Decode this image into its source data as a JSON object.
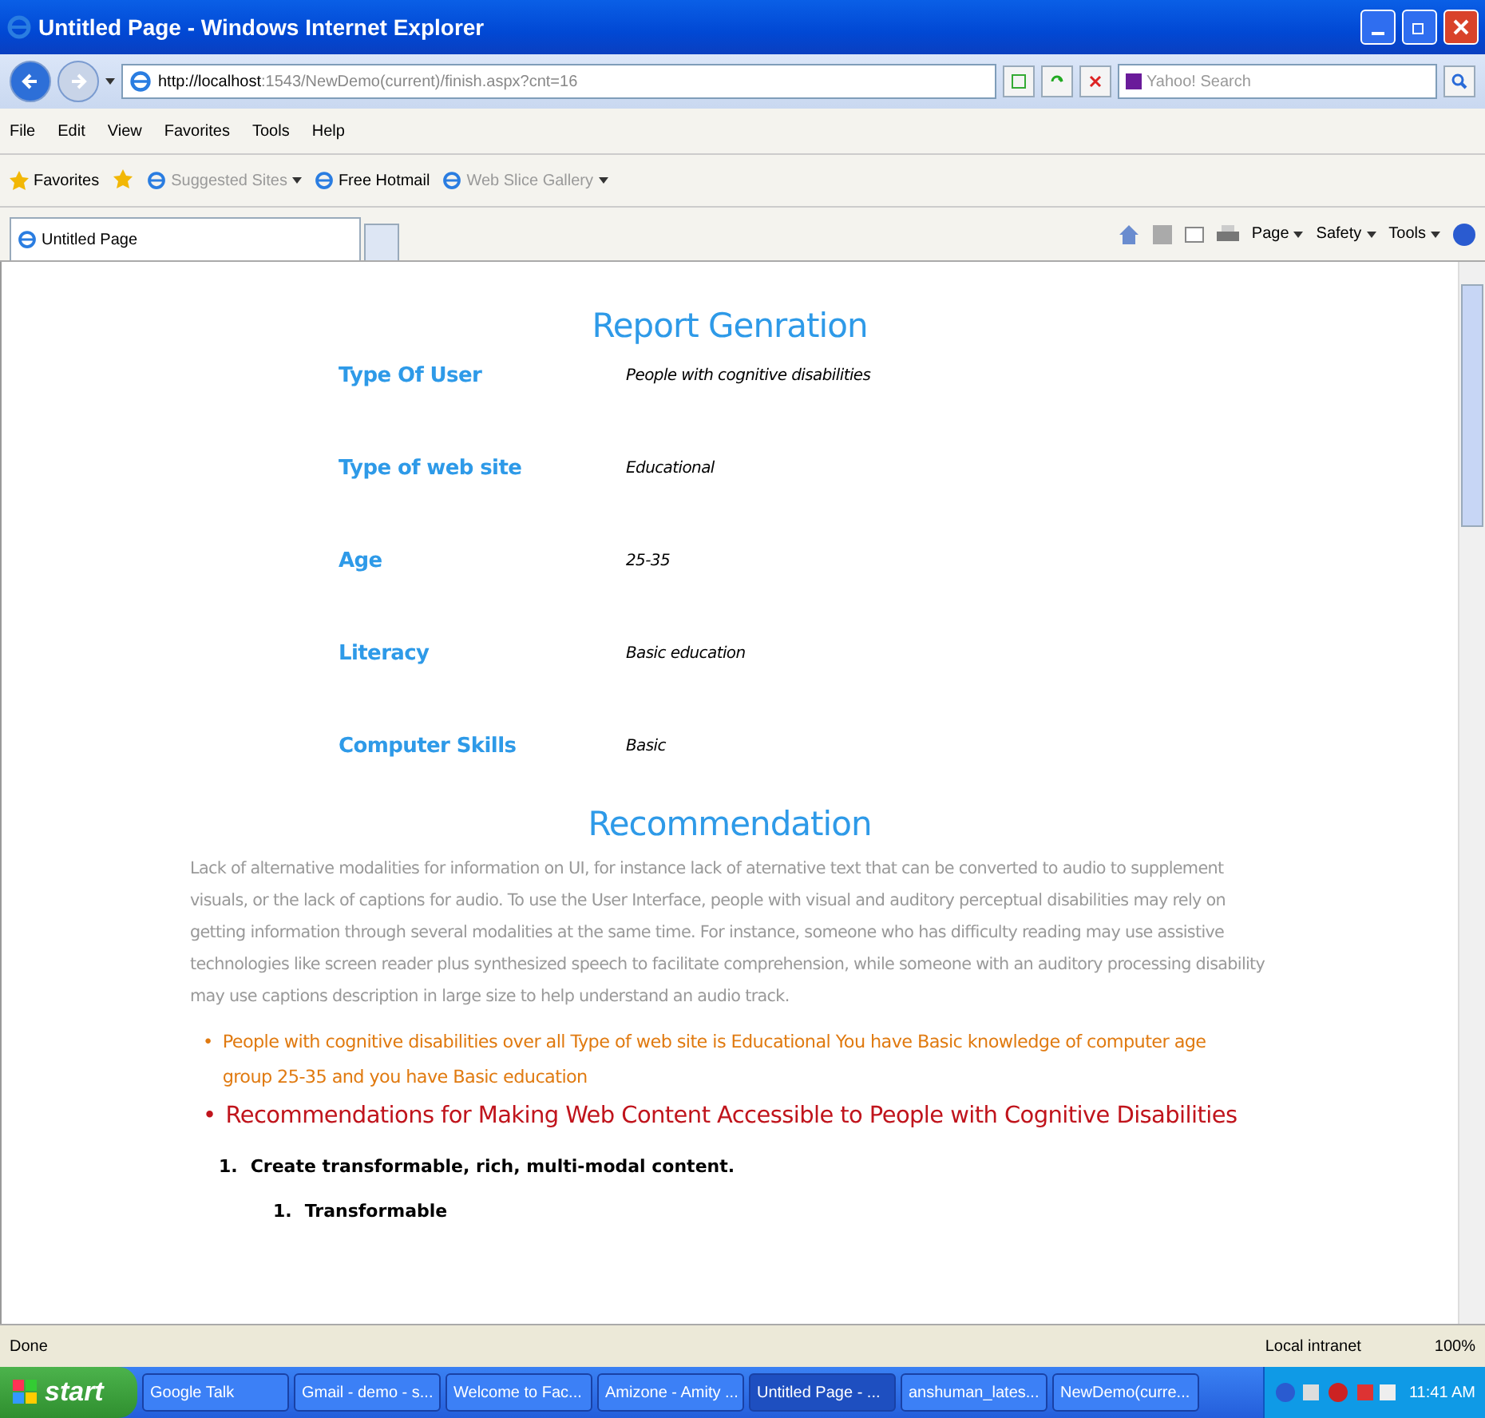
{
  "window": {
    "title": "Untitled Page - Windows Internet Explorer"
  },
  "address_bar": {
    "url_host": "http://localhost",
    "url_rest": ":1543/NewDemo(current)/finish.aspx?cnt=16",
    "search_placeholder": "Yahoo! Search"
  },
  "menu": [
    "File",
    "Edit",
    "View",
    "Favorites",
    "Tools",
    "Help"
  ],
  "favorites_bar": {
    "label": "Favorites",
    "links": [
      {
        "label": "Suggested Sites",
        "dropdown": true,
        "dimmed": true
      },
      {
        "label": "Free Hotmail",
        "dropdown": false,
        "dimmed": false
      },
      {
        "label": "Web Slice Gallery",
        "dropdown": true,
        "dimmed": true
      }
    ]
  },
  "tab": {
    "label": "Untitled Page"
  },
  "command_bar": [
    "Page",
    "Safety",
    "Tools"
  ],
  "page": {
    "title": "Report Genration",
    "fields": [
      {
        "label": "Type Of User",
        "value": "People with cognitive disabilities"
      },
      {
        "label": "Type of web site",
        "value": "Educational"
      },
      {
        "label": "Age",
        "value": "25-35"
      },
      {
        "label": "Literacy",
        "value": "Basic education"
      },
      {
        "label": "Computer Skills",
        "value": "Basic"
      }
    ],
    "recommendation_title": "Recommendation",
    "paragraph": "Lack of alternative modalities for information on UI, for instance lack of aternative text that can be converted to audio to supplement visuals, or the lack of captions for audio. To use the User Interface, people with visual and auditory perceptual disabilities may rely on getting information through several modalities at the same time. For instance, someone who has difficulty reading may use assistive technologies like screen reader plus synthesized speech to facilitate comprehension, while someone with an auditory processing disability may use captions description in large size to help understand an audio track.",
    "bullets": [
      {
        "kind": "summary",
        "marker": "•",
        "text": "People with cognitive disabilities over all Type of web site is Educational You have Basic knowledge of computer age group 25-35 and you have Basic education"
      },
      {
        "kind": "heading",
        "marker": "•",
        "text": "Recommendations for Making Web Content Accessible to People with Cognitive Disabilities"
      }
    ],
    "steps": [
      {
        "number": "1.",
        "text": "Create transformable, rich, multi-modal content.",
        "children": [
          {
            "number": "1.",
            "text": "Transformable"
          }
        ]
      }
    ]
  },
  "status_bar": {
    "text": "Done",
    "zone": "Local intranet",
    "zoom": "100%"
  },
  "taskbar": {
    "start": "start",
    "items": [
      {
        "label": "Google Talk",
        "selected": false
      },
      {
        "label": "Gmail - demo - s...",
        "selected": false
      },
      {
        "label": "Welcome to Fac...",
        "selected": false
      },
      {
        "label": "Amizone - Amity ...",
        "selected": false
      },
      {
        "label": "Untitled Page - ...",
        "selected": true
      },
      {
        "label": "anshuman_lates...",
        "selected": false
      },
      {
        "label": "NewDemo(curre...",
        "selected": false
      }
    ],
    "clock": "11:41 AM"
  }
}
